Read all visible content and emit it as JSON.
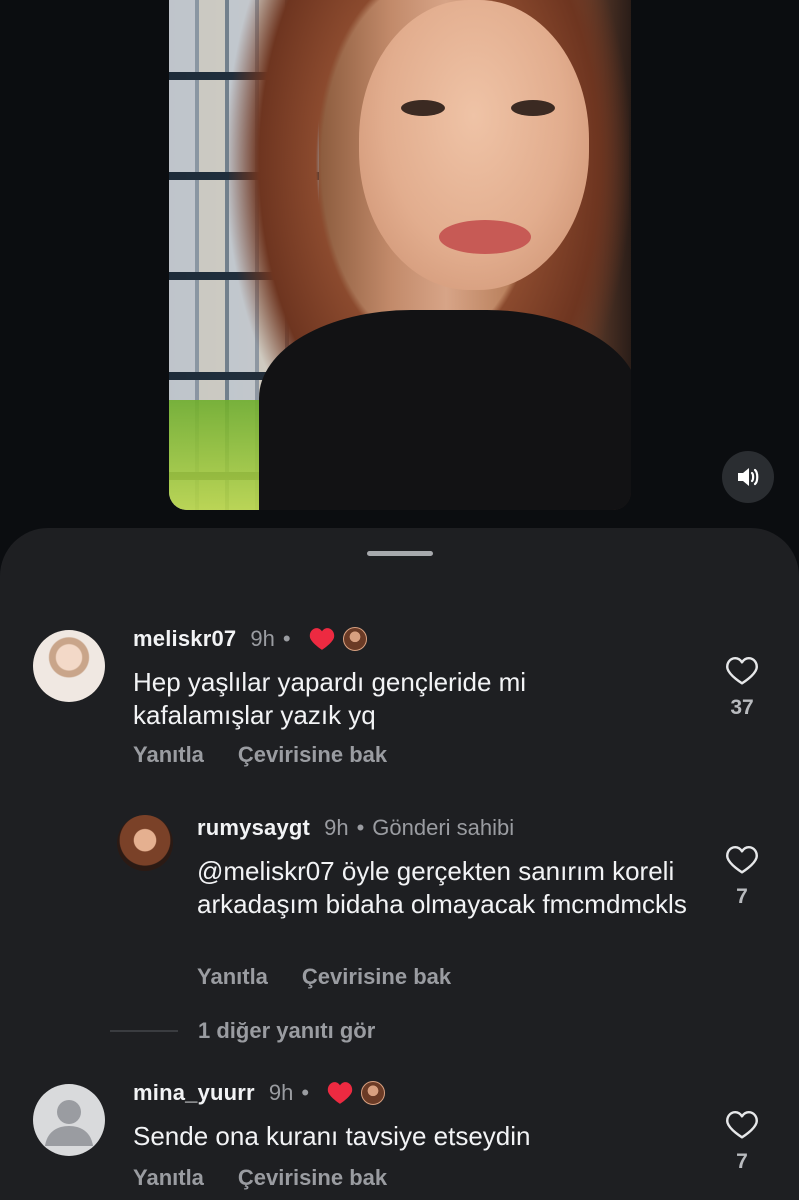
{
  "comments": [
    {
      "username": "meliskr07",
      "time": "9h",
      "text": "Hep yaşlılar yapardı gençleride mi kafalamışlar yazık yq",
      "likes": "37",
      "reply_label": "Yanıtla",
      "translate_label": "Çevirisine bak"
    },
    {
      "username": "rumysaygt",
      "time": "9h",
      "badge": "Gönderi sahibi",
      "text": "@meliskr07 öyle gerçekten sanırım koreli arkadaşım bidaha olmayacak fmcmdmckls",
      "likes": "7",
      "reply_label": "Yanıtla",
      "translate_label": "Çevirisine bak"
    },
    {
      "username": "mina_yuurr",
      "time": "9h",
      "text": "Sende ona kuranı tavsiye etseydin",
      "likes": "7",
      "reply_label": "Yanıtla",
      "translate_label": "Çevirisine bak"
    }
  ],
  "separator": "•",
  "more_replies_label": "1 diğer yanıtı gör",
  "colors": {
    "accent_heart": "#ed2a41",
    "sheet_bg": "#1e1f22",
    "muted_text": "#9a9ca1"
  },
  "icons": {
    "sound": "volume-icon",
    "like": "heart-outline-icon",
    "creator_like": "heart-filled-icon"
  }
}
